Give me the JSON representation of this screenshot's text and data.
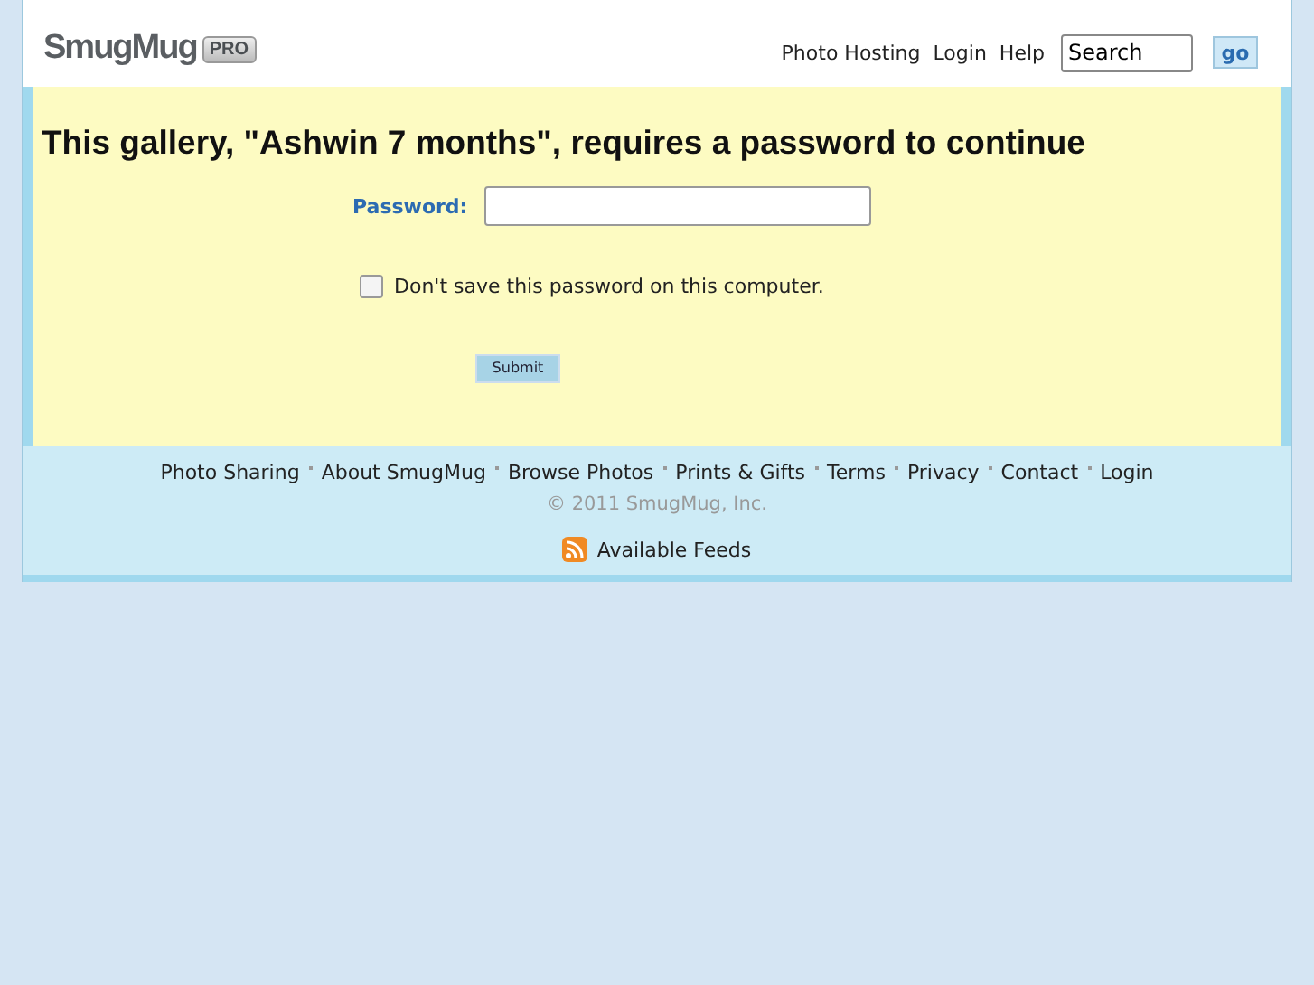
{
  "header": {
    "logo": "SmugMug",
    "logo_badge": "PRO",
    "nav": [
      "Photo Hosting",
      "Login",
      "Help"
    ],
    "search": {
      "value": "Search"
    },
    "go_button": "go"
  },
  "panel": {
    "title": "This gallery, \"Ashwin 7 months\", requires a password to continue",
    "password_label": "Password:",
    "checkbox": {
      "label": "Don't save this password on this computer.",
      "checked": false
    },
    "submit": "Submit"
  },
  "footer": {
    "links": [
      "Photo Sharing",
      "About SmugMug",
      "Browse Photos",
      "Prints & Gifts",
      "Terms",
      "Privacy",
      "Contact",
      "Login"
    ],
    "copyright": "© 2011 SmugMug, Inc.",
    "feeds": "Available Feeds"
  }
}
